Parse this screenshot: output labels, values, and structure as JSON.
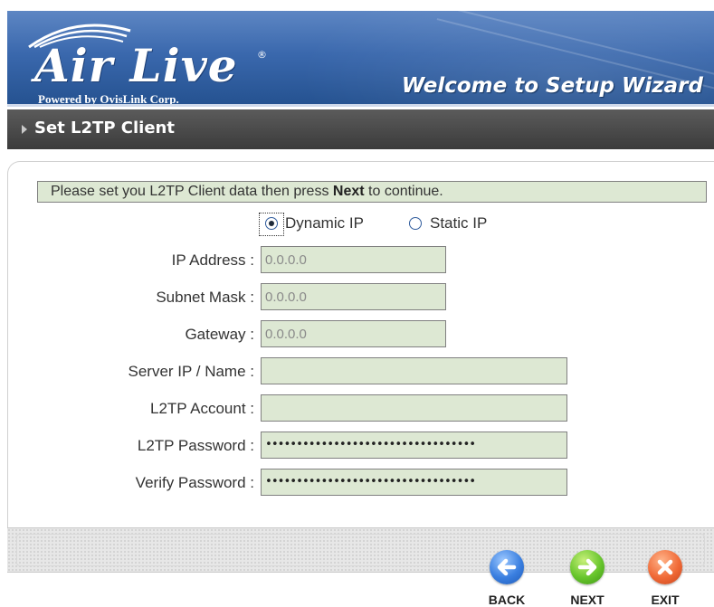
{
  "header": {
    "brand_name": "Air Live",
    "brand_mark": "®",
    "brand_tagline": "Powered by OvisLink Corp.",
    "wizard_title": "Welcome to Setup Wizard"
  },
  "section": {
    "title": "Set L2TP Client"
  },
  "notice": {
    "text_before": "Please set you L2TP Client data then press ",
    "text_bold": "Next",
    "text_after": " to continue."
  },
  "ip_mode": {
    "options": [
      "Dynamic IP",
      "Static IP"
    ],
    "selected": "Dynamic IP"
  },
  "form": {
    "ip_address": {
      "label": "IP Address :",
      "value": "0.0.0.0"
    },
    "subnet_mask": {
      "label": "Subnet Mask :",
      "value": "0.0.0.0"
    },
    "gateway": {
      "label": "Gateway :",
      "value": "0.0.0.0"
    },
    "server": {
      "label": "Server IP / Name :",
      "value": ""
    },
    "account": {
      "label": "L2TP Account :",
      "value": ""
    },
    "password": {
      "label": "L2TP Password :",
      "value": "••••••••••••••••••••••••••••••••••"
    },
    "verify": {
      "label": "Verify Password :",
      "value": "••••••••••••••••••••••••••••••••••"
    }
  },
  "footer": {
    "back_label": "BACK",
    "next_label": "NEXT",
    "exit_label": "EXIT"
  },
  "colors": {
    "header_blue": "#3a68ad",
    "section_bar": "#4a4a4a",
    "field_bg": "#dde8d3",
    "back_blue": "#3a7fe0",
    "next_green": "#67c52c",
    "exit_orange": "#f06a37"
  },
  "icons": [
    "arrow-left-icon",
    "arrow-right-icon",
    "close-icon",
    "section-arrow-icon",
    "logo-swoosh-icon"
  ]
}
